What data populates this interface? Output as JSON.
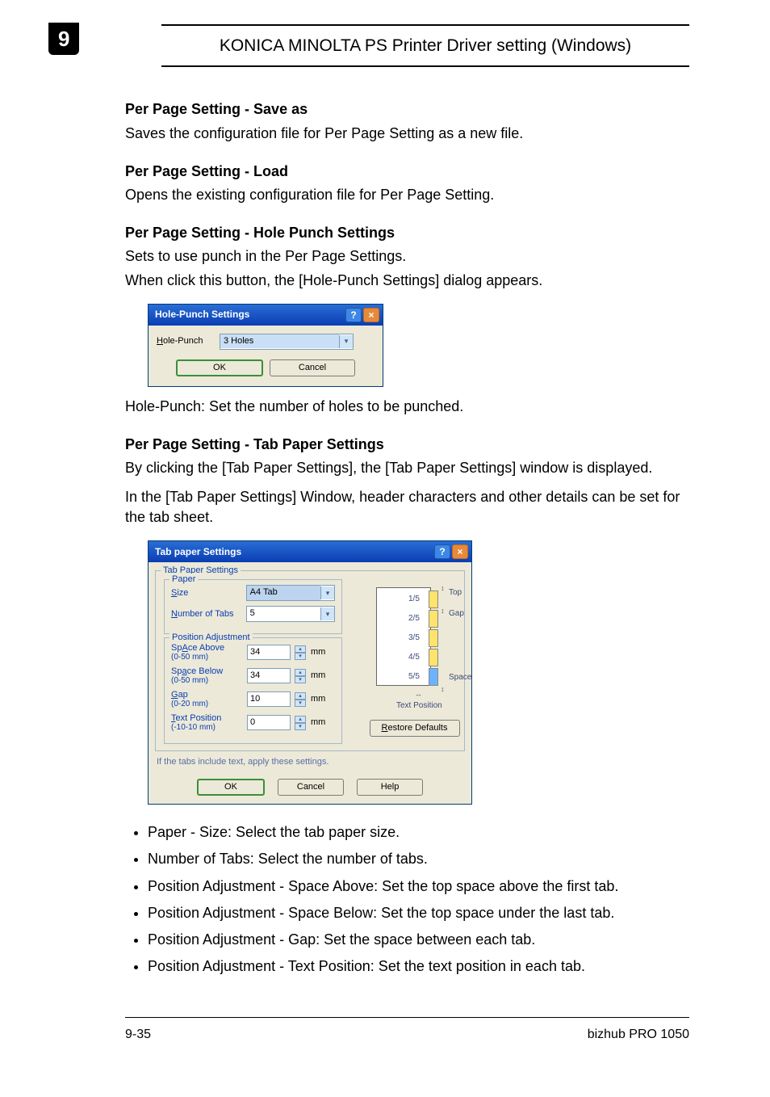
{
  "chapter": "9",
  "header_title": "KONICA MINOLTA PS Printer Driver setting (Windows)",
  "sections": {
    "save_as": {
      "title": "Per Page Setting - Save as",
      "desc": "Saves the configuration file for Per Page Setting as a new file."
    },
    "load": {
      "title": "Per Page Setting - Load",
      "desc": "Opens the existing configuration file for Per Page Setting."
    },
    "hole_punch": {
      "title": "Per Page Setting - Hole Punch Settings",
      "desc1": "Sets to use punch in the Per Page Settings.",
      "desc2": "When click this button, the [Hole-Punch Settings] dialog appears.",
      "desc3": "Hole-Punch: Set the number of holes to be punched."
    },
    "tab_paper": {
      "title": "Per Page Setting - Tab Paper Settings",
      "desc1": "By clicking the [Tab Paper Settings], the [Tab Paper Settings] window is displayed.",
      "desc2": "In the [Tab Paper Settings] Window, header characters and other details can be set for the tab sheet."
    }
  },
  "dialog_hp": {
    "title": "Hole-Punch Settings",
    "label_suffix": "ole-Punch",
    "value": "3 Holes",
    "ok": "OK",
    "cancel": "Cancel"
  },
  "dialog_tp": {
    "title": "Tab paper Settings",
    "group": "Tab Paper Settings",
    "paper_group": "Paper",
    "size_label_u": "S",
    "size_label_rest": "ize",
    "size_value": "A4 Tab",
    "num_tabs_label_u": "N",
    "num_tabs_label_rest": "umber of Tabs",
    "num_tabs_value": "5",
    "pa_group": "Position Adjustment",
    "space_above_u": "A",
    "space_above_label": "Sp",
    "space_above_rest": "ce Above",
    "space_above_range": "(0-50 mm)",
    "space_above_val": "34",
    "space_below_u": "a",
    "space_below_label": "Sp",
    "space_below_rest": "ce Below",
    "space_below_range": "(0-50 mm)",
    "space_below_val": "34",
    "gap_u": "G",
    "gap_rest": "ap",
    "gap_range": "(0-20 mm)",
    "gap_val": "10",
    "tp_u": "T",
    "tp_rest": "ext Position",
    "tp_range": "(-10-10 mm)",
    "tp_val": "0",
    "unit": "mm",
    "restore_u": "R",
    "restore_rest": "estore Defaults",
    "instr": "If the tabs include text, apply these settings.",
    "ok": "OK",
    "cancel": "Cancel",
    "help": "Help",
    "preview": {
      "tabs": [
        "1/5",
        "2/5",
        "3/5",
        "4/5",
        "5/5"
      ],
      "top": "Top",
      "gap": "Gap",
      "space": "Space",
      "textpos": "Text Position"
    }
  },
  "bullets": [
    "Paper - Size: Select the tab paper size.",
    "Number of Tabs: Select the number of tabs.",
    "Position Adjustment - Space Above: Set the top space above the first tab.",
    "Position Adjustment - Space Below: Set the top space under the last tab.",
    "Position Adjustment - Gap: Set the space between each tab.",
    "Position Adjustment - Text Position: Set the text position in each tab."
  ],
  "footer_left": "9-35",
  "footer_right": "bizhub PRO 1050"
}
